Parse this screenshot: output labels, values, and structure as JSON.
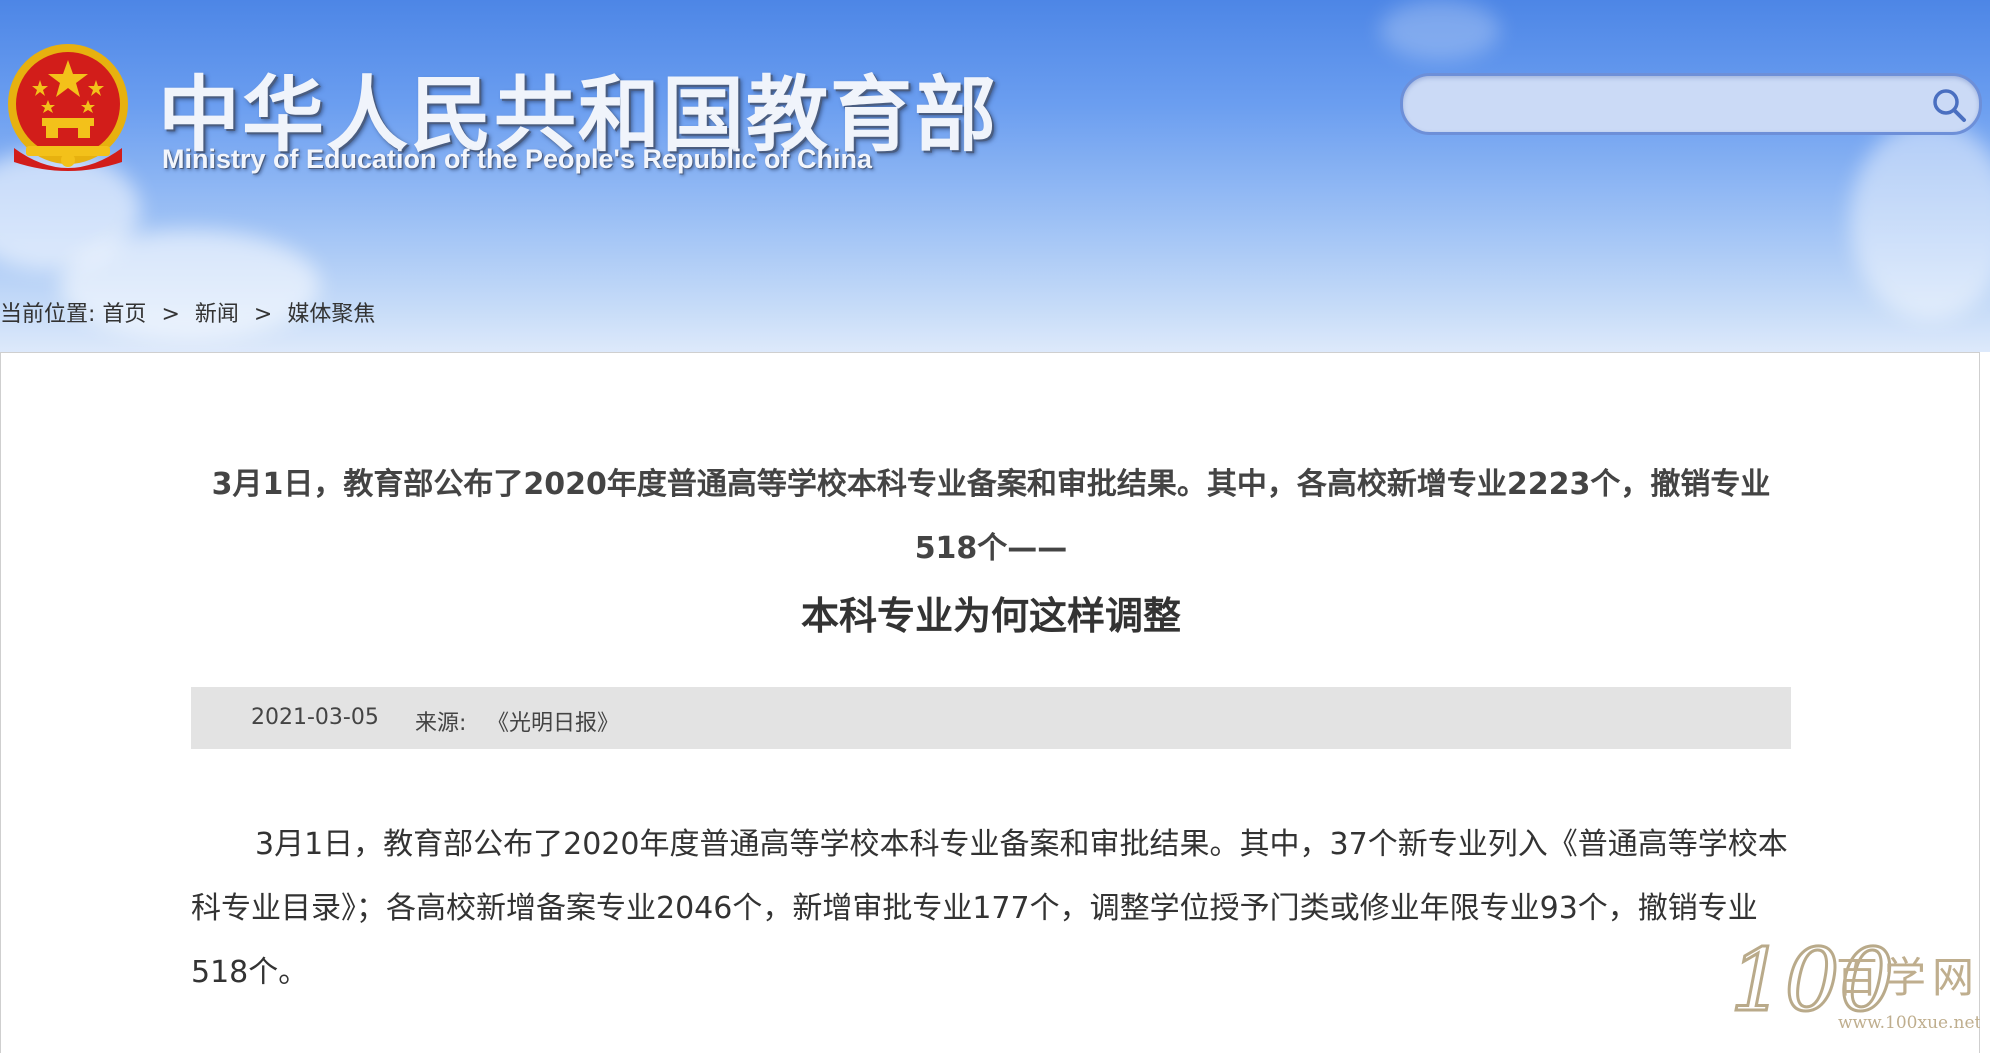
{
  "header": {
    "title_cn": "中华人民共和国教育部",
    "title_en": "Ministry of Education of the People's Republic of China",
    "search_placeholder": ""
  },
  "breadcrumb": {
    "prefix": "当前位置:",
    "items": [
      "首页",
      "新闻",
      "媒体聚焦"
    ],
    "separator": ">"
  },
  "article": {
    "lead": "3月1日，教育部公布了2020年度普通高等学校本科专业备案和审批结果。其中，各高校新增专业2223个，撤销专业518个——",
    "title": "本科专业为何这样调整",
    "date": "2021-03-05",
    "source_label": "来源:",
    "source": "《光明日报》",
    "paragraph1": "3月1日，教育部公布了2020年度普通高等学校本科专业备案和审批结果。其中，37个新专业列入《普通高等学校本科专业目录》；各高校新增备案专业2046个，新增审批专业177个，调整学位授予门类或修业年限专业93个，撤销专业518个。"
  },
  "watermark": {
    "number": "100",
    "name": "百学网",
    "url": "www.100xue.net"
  },
  "colors": {
    "header_top": "#4d86e6",
    "header_bottom": "#dde9fb",
    "search_border": "#6d8fd8",
    "meta_bar": "#e3e3e3",
    "emblem_red": "#d21d1a",
    "emblem_gold": "#f3c11a"
  },
  "icons": {
    "emblem": "national-emblem",
    "search": "search-icon"
  }
}
